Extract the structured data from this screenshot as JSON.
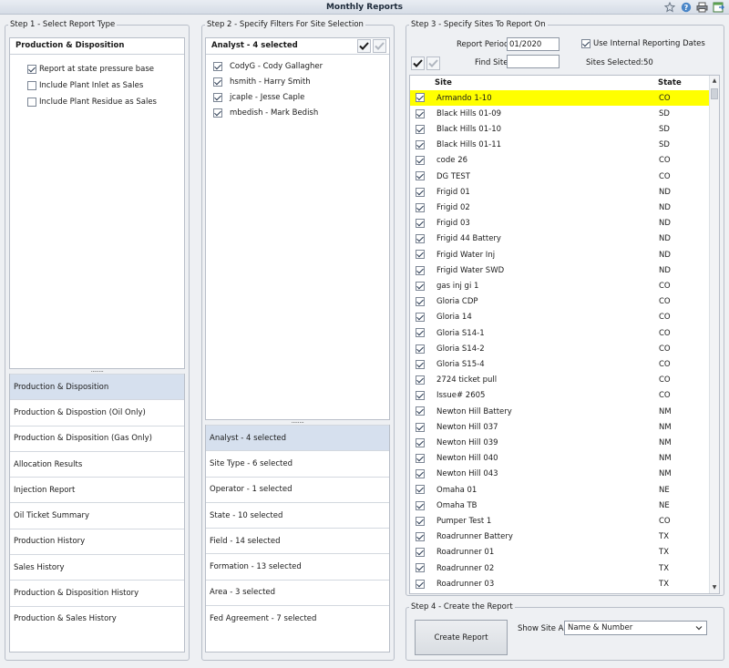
{
  "window": {
    "title": "Monthly Reports"
  },
  "toolbar": {
    "icons": [
      "star-icon",
      "help-icon",
      "print-icon",
      "export-icon"
    ]
  },
  "step1": {
    "legend": "Step 1 - Select Report Type",
    "header": "Production & Disposition",
    "options": [
      {
        "label": "Report at state pressure base",
        "checked": true
      },
      {
        "label": "Include Plant Inlet as Sales",
        "checked": false
      },
      {
        "label": "Include Plant Residue as Sales",
        "checked": false
      }
    ],
    "splitter": "........",
    "report_types": [
      {
        "label": "Production & Disposition",
        "active": true
      },
      {
        "label": "Production & Dispostion (Oil Only)",
        "active": false
      },
      {
        "label": "Production & Disposition (Gas Only)",
        "active": false
      },
      {
        "label": "Allocation Results",
        "active": false
      },
      {
        "label": "Injection Report",
        "active": false
      },
      {
        "label": "Oil Ticket Summary",
        "active": false
      },
      {
        "label": "Production History",
        "active": false
      },
      {
        "label": "Sales History",
        "active": false
      },
      {
        "label": "Production & Disposition History",
        "active": false
      },
      {
        "label": "Production & Sales History",
        "active": false
      }
    ]
  },
  "step2": {
    "legend": "Step 2 - Specify Filters For Site Selection",
    "header": "Analyst - 4 selected",
    "analysts": [
      {
        "label": "CodyG - Cody Gallagher",
        "checked": true
      },
      {
        "label": "hsmith - Harry Smith",
        "checked": true
      },
      {
        "label": "jcaple - Jesse Caple",
        "checked": true
      },
      {
        "label": "mbedish - Mark Bedish",
        "checked": true
      }
    ],
    "splitter": "........",
    "filters": [
      {
        "label": "Analyst - 4 selected",
        "active": true
      },
      {
        "label": "Site Type - 6 selected",
        "active": false
      },
      {
        "label": "Operator - 1 selected",
        "active": false
      },
      {
        "label": "State - 10 selected",
        "active": false
      },
      {
        "label": "Field - 14 selected",
        "active": false
      },
      {
        "label": "Formation - 13 selected",
        "active": false
      },
      {
        "label": "Area - 3 selected",
        "active": false
      },
      {
        "label": "Fed Agreement - 7 selected",
        "active": false
      }
    ]
  },
  "step3": {
    "legend": "Step 3 - Specify Sites To Report On",
    "report_period_label": "Report Period",
    "report_period_value": "01/2020",
    "use_internal_label": "Use Internal Reporting Dates",
    "use_internal_checked": true,
    "find_site_label": "Find Site",
    "find_site_value": "",
    "sites_selected_label": "Sites Selected:",
    "sites_selected_value": "50",
    "col_site": "Site",
    "col_state": "State",
    "sites": [
      {
        "site": "Armando 1-10",
        "state": "CO",
        "checked": true,
        "selected": true
      },
      {
        "site": "Black Hills 01-09",
        "state": "SD",
        "checked": true
      },
      {
        "site": "Black Hills 01-10",
        "state": "SD",
        "checked": true
      },
      {
        "site": "Black Hills 01-11",
        "state": "SD",
        "checked": true
      },
      {
        "site": "code 26",
        "state": "CO",
        "checked": true
      },
      {
        "site": "DG TEST",
        "state": "CO",
        "checked": true
      },
      {
        "site": "Frigid 01",
        "state": "ND",
        "checked": true
      },
      {
        "site": "Frigid 02",
        "state": "ND",
        "checked": true
      },
      {
        "site": "Frigid 03",
        "state": "ND",
        "checked": true
      },
      {
        "site": "Frigid 44 Battery",
        "state": "ND",
        "checked": true
      },
      {
        "site": "Frigid Water Inj",
        "state": "ND",
        "checked": true
      },
      {
        "site": "Frigid Water SWD",
        "state": "ND",
        "checked": true
      },
      {
        "site": "gas inj gi 1",
        "state": "CO",
        "checked": true
      },
      {
        "site": "Gloria CDP",
        "state": "CO",
        "checked": true
      },
      {
        "site": "Gloria 14",
        "state": "CO",
        "checked": true
      },
      {
        "site": "Gloria S14-1",
        "state": "CO",
        "checked": true
      },
      {
        "site": "Gloria S14-2",
        "state": "CO",
        "checked": true
      },
      {
        "site": "Gloria S15-4",
        "state": "CO",
        "checked": true
      },
      {
        "site": "2724 ticket pull",
        "state": "CO",
        "checked": true
      },
      {
        "site": "Issue# 2605",
        "state": "CO",
        "checked": true
      },
      {
        "site": "Newton Hill Battery",
        "state": "NM",
        "checked": true
      },
      {
        "site": "Newton Hill 037",
        "state": "NM",
        "checked": true
      },
      {
        "site": "Newton Hill 039",
        "state": "NM",
        "checked": true
      },
      {
        "site": "Newton Hill 040",
        "state": "NM",
        "checked": true
      },
      {
        "site": "Newton Hill 043",
        "state": "NM",
        "checked": true
      },
      {
        "site": "Omaha 01",
        "state": "NE",
        "checked": true
      },
      {
        "site": "Omaha TB",
        "state": "NE",
        "checked": true
      },
      {
        "site": "Pumper Test 1",
        "state": "CO",
        "checked": true
      },
      {
        "site": "Roadrunner Battery",
        "state": "TX",
        "checked": true
      },
      {
        "site": "Roadrunner 01",
        "state": "TX",
        "checked": true
      },
      {
        "site": "Roadrunner 02",
        "state": "TX",
        "checked": true
      },
      {
        "site": "Roadrunner 03",
        "state": "TX",
        "checked": true
      }
    ]
  },
  "step4": {
    "legend": "Step 4 - Create the Report",
    "create_label": "Create Report",
    "show_as_label": "Show Site As",
    "show_as_value": "Name & Number"
  }
}
